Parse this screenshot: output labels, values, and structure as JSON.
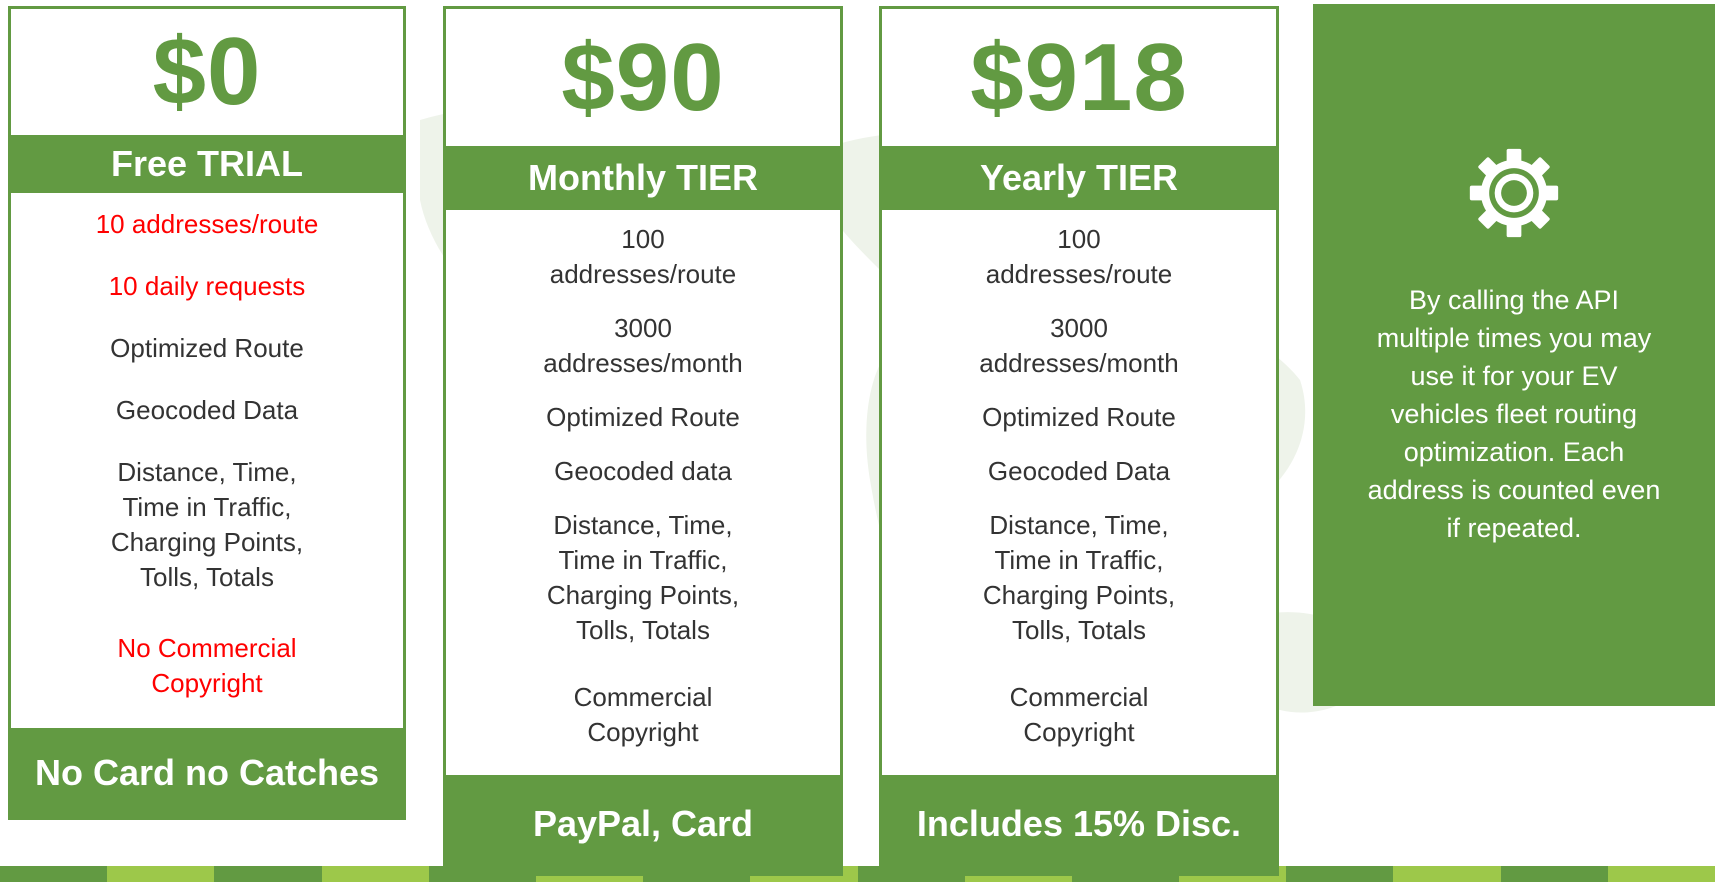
{
  "colors": {
    "brand_green": "#629a42",
    "light_green": "#9dc84a",
    "warning_red": "#ff0000",
    "text_dark": "#333333",
    "white": "#ffffff"
  },
  "plans": [
    {
      "price": "$0",
      "tier": "Free TRIAL",
      "features": [
        "10 addresses/route",
        "10 daily requests",
        "Optimized Route",
        "Geocoded Data",
        "Distance, Time,\nTime in Traffic,\nCharging Points,\nTolls, Totals",
        "No Commercial\nCopyright"
      ],
      "footer": "No Card no Catches"
    },
    {
      "price": "$90",
      "tier": "Monthly TIER",
      "features": [
        "100\naddresses/route",
        "3000\naddresses/month",
        "Optimized Route",
        "Geocoded data",
        "Distance, Time,\nTime in Traffic,\nCharging Points,\nTolls, Totals",
        "Commercial\nCopyright"
      ],
      "footer": "PayPal, Card"
    },
    {
      "price": "$918",
      "tier": "Yearly TIER",
      "features": [
        "100\naddresses/route",
        "3000\naddresses/month",
        "Optimized Route",
        "Geocoded Data",
        "Distance, Time,\nTime in Traffic,\nCharging Points,\nTolls, Totals",
        "Commercial\nCopyright"
      ],
      "footer": "Includes 15% Disc."
    }
  ],
  "info": {
    "icon": "gear-icon",
    "text": "By calling the API multiple times you may use it for your EV vehicles fleet routing optimization. Each address is counted even if repeated."
  }
}
